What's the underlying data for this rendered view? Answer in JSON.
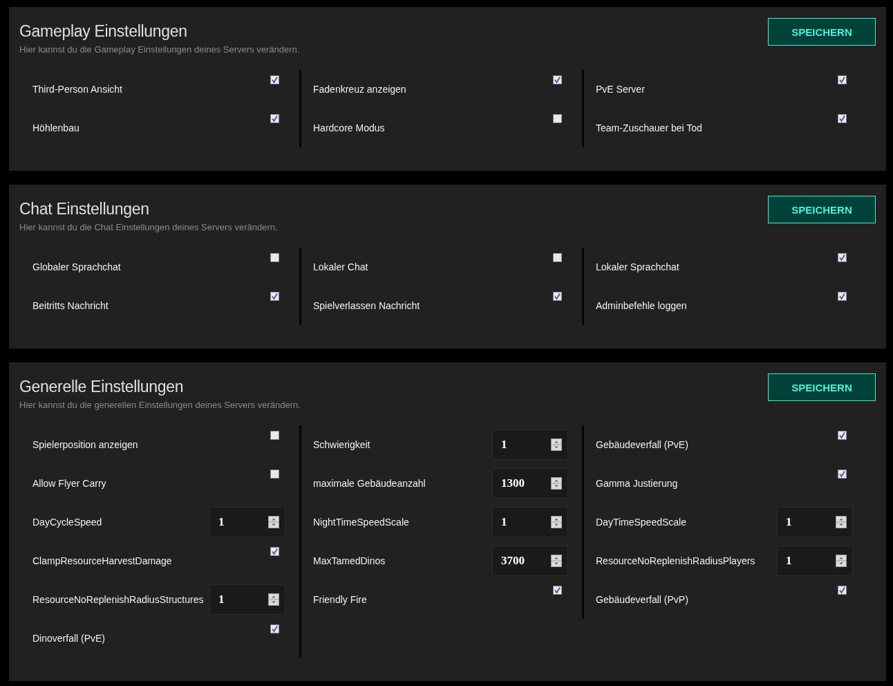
{
  "sections": [
    {
      "title": "Gameplay Einstellungen",
      "description": "Hier kannst du die Gameplay Einstellungen deines Servers verändern.",
      "button": "SPEICHERN",
      "columns": [
        [
          {
            "kind": "checkbox",
            "label": "Third-Person Ansicht",
            "checked": true
          },
          {
            "kind": "checkbox",
            "label": "Höhlenbau",
            "checked": true
          }
        ],
        [
          {
            "kind": "checkbox",
            "label": "Fadenkreuz anzeigen",
            "checked": true
          },
          {
            "kind": "checkbox",
            "label": "Hardcore Modus",
            "checked": false
          }
        ],
        [
          {
            "kind": "checkbox",
            "label": "PvE Server",
            "checked": true
          },
          {
            "kind": "checkbox",
            "label": "Team-Zuschauer bei Tod",
            "checked": true
          }
        ]
      ]
    },
    {
      "title": "Chat Einstellungen",
      "description": "Hier kannst du die Chat Einstellungen deines Servers verändern.",
      "button": "SPEICHERN",
      "columns": [
        [
          {
            "kind": "checkbox",
            "label": "Globaler Sprachchat",
            "checked": false
          },
          {
            "kind": "checkbox",
            "label": "Beitritts Nachricht",
            "checked": true
          }
        ],
        [
          {
            "kind": "checkbox",
            "label": "Lokaler Chat",
            "checked": false
          },
          {
            "kind": "checkbox",
            "label": "Spielverlassen Nachricht",
            "checked": true
          }
        ],
        [
          {
            "kind": "checkbox",
            "label": "Lokaler Sprachchat",
            "checked": true
          },
          {
            "kind": "checkbox",
            "label": "Adminbefehle loggen",
            "checked": true
          }
        ]
      ]
    },
    {
      "title": "Generelle Einstellungen",
      "description": "Hier kannst du die generellen Einstellungen deines Servers verändern.",
      "button": "SPEICHERN",
      "columns": [
        [
          {
            "kind": "checkbox",
            "label": "Spielerposition anzeigen",
            "checked": false
          },
          {
            "kind": "checkbox",
            "label": "Allow Flyer Carry",
            "checked": false
          },
          {
            "kind": "number",
            "label": "DayCycleSpeed",
            "value": "1"
          },
          {
            "kind": "checkbox",
            "label": "ClampResourceHarvestDamage",
            "checked": true
          },
          {
            "kind": "number",
            "label": "ResourceNoReplenishRadiusStructures",
            "value": "1"
          },
          {
            "kind": "checkbox",
            "label": "Dinoverfall (PvE)",
            "checked": true
          }
        ],
        [
          {
            "kind": "number",
            "label": "Schwierigkeit",
            "value": "1"
          },
          {
            "kind": "number",
            "label": "maximale Gebäudeanzahl",
            "value": "1300"
          },
          {
            "kind": "number",
            "label": "NightTimeSpeedScale",
            "value": "1"
          },
          {
            "kind": "number",
            "label": "MaxTamedDinos",
            "value": "3700"
          },
          {
            "kind": "checkbox",
            "label": "Friendly Fire",
            "checked": true
          }
        ],
        [
          {
            "kind": "checkbox",
            "label": "Gebäudeverfall (PvE)",
            "checked": true
          },
          {
            "kind": "checkbox",
            "label": "Gamma Justierung",
            "checked": true
          },
          {
            "kind": "number",
            "label": "DayTimeSpeedScale",
            "value": "1"
          },
          {
            "kind": "number",
            "label": "ResourceNoReplenishRadiusPlayers",
            "value": "1"
          },
          {
            "kind": "checkbox",
            "label": "Gebäudeverfall (PvP)",
            "checked": true
          }
        ]
      ]
    }
  ]
}
